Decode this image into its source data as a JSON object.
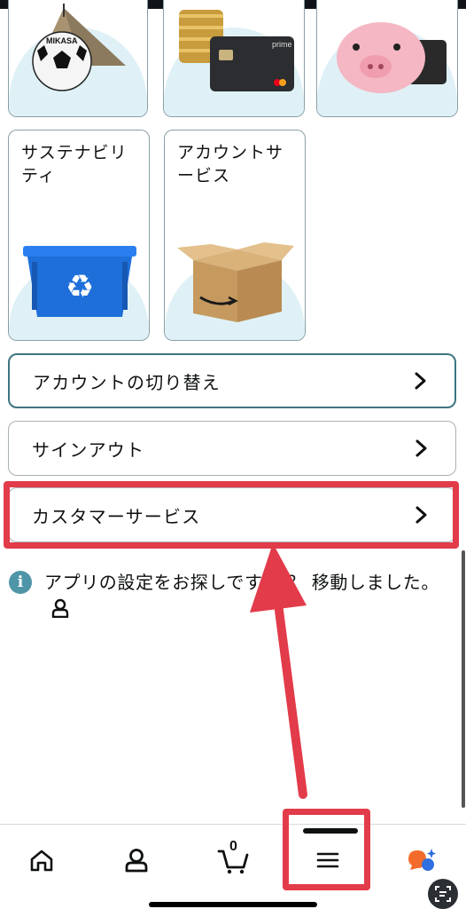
{
  "tiles": {
    "sustainability_label": "サステナビリ\nティ",
    "account_service_label": "アカウントサ\nービス"
  },
  "rows": {
    "switch_account": "アカウントの切り替え",
    "sign_out": "サインアウト",
    "customer_service": "カスタマーサービス"
  },
  "info": {
    "message": "アプリの設定をお探しです か？ 移動しました。",
    "icon": "info-icon"
  },
  "bottom_nav": {
    "cart_count": "0",
    "items": [
      "home-icon",
      "account-icon",
      "cart-icon",
      "menu-icon",
      "rufus-icon"
    ]
  },
  "colors": {
    "highlight": "#e23b4a",
    "accent": "#3d7480",
    "tile_bg": "#dff1f6"
  }
}
